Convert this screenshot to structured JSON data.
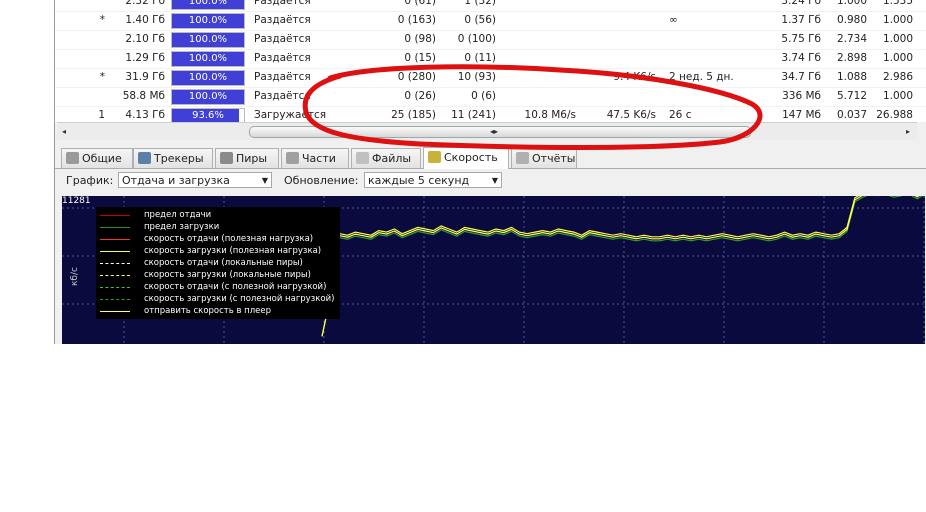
{
  "torrents": {
    "rows": [
      {
        "queue": "",
        "size": "2.32 Гб",
        "progress": 1.0,
        "progress_label": "100.0%",
        "status": "Раздаётся",
        "seeds": "0 (61)",
        "peers": "1 (32)",
        "down": "",
        "up": "",
        "eta": "",
        "uploaded": "3.24 Гб",
        "ratio": "1.000",
        "avail": "1.535"
      },
      {
        "queue": "*",
        "size": "1.40 Гб",
        "progress": 1.0,
        "progress_label": "100.0%",
        "status": "Раздаётся",
        "seeds": "0 (163)",
        "peers": "0 (56)",
        "down": "",
        "up": "",
        "eta": "∞",
        "uploaded": "1.37 Гб",
        "ratio": "0.980",
        "avail": "1.000"
      },
      {
        "queue": "",
        "size": "2.10 Гб",
        "progress": 1.0,
        "progress_label": "100.0%",
        "status": "Раздаётся",
        "seeds": "0 (98)",
        "peers": "0 (100)",
        "down": "",
        "up": "",
        "eta": "",
        "uploaded": "5.75 Гб",
        "ratio": "2.734",
        "avail": "1.000"
      },
      {
        "queue": "",
        "size": "1.29 Гб",
        "progress": 1.0,
        "progress_label": "100.0%",
        "status": "Раздаётся",
        "seeds": "0 (15)",
        "peers": "0 (11)",
        "down": "",
        "up": "",
        "eta": "",
        "uploaded": "3.74 Гб",
        "ratio": "2.898",
        "avail": "1.000"
      },
      {
        "queue": "*",
        "size": "31.9 Гб",
        "progress": 1.0,
        "progress_label": "100.0%",
        "status": "Раздаётся",
        "seeds": "0 (280)",
        "peers": "10 (93)",
        "down": "",
        "up": "9.4 K6/s",
        "eta": "2 нед. 5 дн.",
        "uploaded": "34.7 Гб",
        "ratio": "1.088",
        "avail": "2.986"
      },
      {
        "queue": "",
        "size": "58.8 Мб",
        "progress": 1.0,
        "progress_label": "100.0%",
        "status": "Раздаётся",
        "seeds": "0 (26)",
        "peers": "0 (6)",
        "down": "",
        "up": "",
        "eta": "",
        "uploaded": "336 Мб",
        "ratio": "5.712",
        "avail": "1.000"
      },
      {
        "queue": "1",
        "size": "4.13 Гб",
        "progress": 0.936,
        "progress_label": "93.6%",
        "status": "Загружается",
        "seeds": "25 (185)",
        "peers": "11 (241)",
        "down": "10.8 M6/s",
        "up": "47.5 K6/s",
        "eta": "26 c",
        "uploaded": "147 Мб",
        "ratio": "0.037",
        "avail": "26.988"
      }
    ]
  },
  "hscroll": {
    "left_arrow": "◂",
    "right_arrow": "▸",
    "grip": "◂▸"
  },
  "tabs": [
    {
      "label": "Общие",
      "icon": "info-icon",
      "color": "#9a9a9a"
    },
    {
      "label": "Трекеры",
      "icon": "trackers-icon",
      "color": "#5b7fa8"
    },
    {
      "label": "Пиры",
      "icon": "peers-icon",
      "color": "#8a8a8a"
    },
    {
      "label": "Части",
      "icon": "pieces-icon",
      "color": "#a0a0a0"
    },
    {
      "label": "Файлы",
      "icon": "files-icon",
      "color": "#c0c0c0"
    },
    {
      "label": "Скорость",
      "icon": "speed-icon",
      "color": "#c9b23a",
      "active": true
    },
    {
      "label": "Отчёты",
      "icon": "logs-icon",
      "color": "#b0b0b0"
    }
  ],
  "options": {
    "graph_label": "График:",
    "graph_value": "Отдача и загрузка",
    "update_label": "Обновление:",
    "update_value": "каждые 5 секунд"
  },
  "graph": {
    "y_max_label": "11281",
    "unit": "кб/с",
    "background": "#0a0a3e",
    "legend": [
      {
        "label": "предел отдачи",
        "color": "#cc0000",
        "dash": false
      },
      {
        "label": "предел загрузки",
        "color": "#2e8b2e",
        "dash": false
      },
      {
        "label": "скорость отдачи (полезная нагрузка)",
        "color": "#ff3030",
        "dash": false
      },
      {
        "label": "скорость загрузки (полезная нагрузка)",
        "color": "#ffff40",
        "dash": false
      },
      {
        "label": "скорость отдачи (локальные пиры)",
        "color": "#ffffff",
        "dash": true
      },
      {
        "label": "скорость загрузки (локальные пиры)",
        "color": "#ffff80",
        "dash": true
      },
      {
        "label": "скорость отдачи (с полезной нагрузкой)",
        "color": "#40c040",
        "dash": true
      },
      {
        "label": "скорость загрузки (с полезной нагрузкой)",
        "color": "#30a030",
        "dash": true
      },
      {
        "label": "отправить скорость в плеер",
        "color": "#ffff60",
        "dash": false
      }
    ],
    "download_series": [
      0.72,
      0.71,
      0.7,
      0.72,
      0.71,
      0.7,
      0.73,
      0.72,
      0.74,
      0.71,
      0.73,
      0.75,
      0.74,
      0.73,
      0.76,
      0.74,
      0.72,
      0.75,
      0.74,
      0.73,
      0.72,
      0.74,
      0.73,
      0.75,
      0.72,
      0.71,
      0.72,
      0.73,
      0.72,
      0.74,
      0.73,
      0.72,
      0.7,
      0.73,
      0.72,
      0.71,
      0.7,
      0.71,
      0.7,
      0.69,
      0.7,
      0.69,
      0.69,
      0.7,
      0.69,
      0.7,
      0.69,
      0.7,
      0.69,
      0.7,
      0.71,
      0.7,
      0.69,
      0.7,
      0.71,
      0.7,
      0.69,
      0.7,
      0.72,
      0.7,
      0.71,
      0.7,
      0.72,
      0.71,
      0.7,
      0.71,
      0.75,
      0.94,
      0.97,
      0.99,
      0.98,
      0.99,
      0.97,
      0.98,
      0.99,
      0.96,
      0.99
    ],
    "download_drop": [
      0.05,
      0.23
    ]
  },
  "annotation": {
    "color": "#dd1111"
  }
}
